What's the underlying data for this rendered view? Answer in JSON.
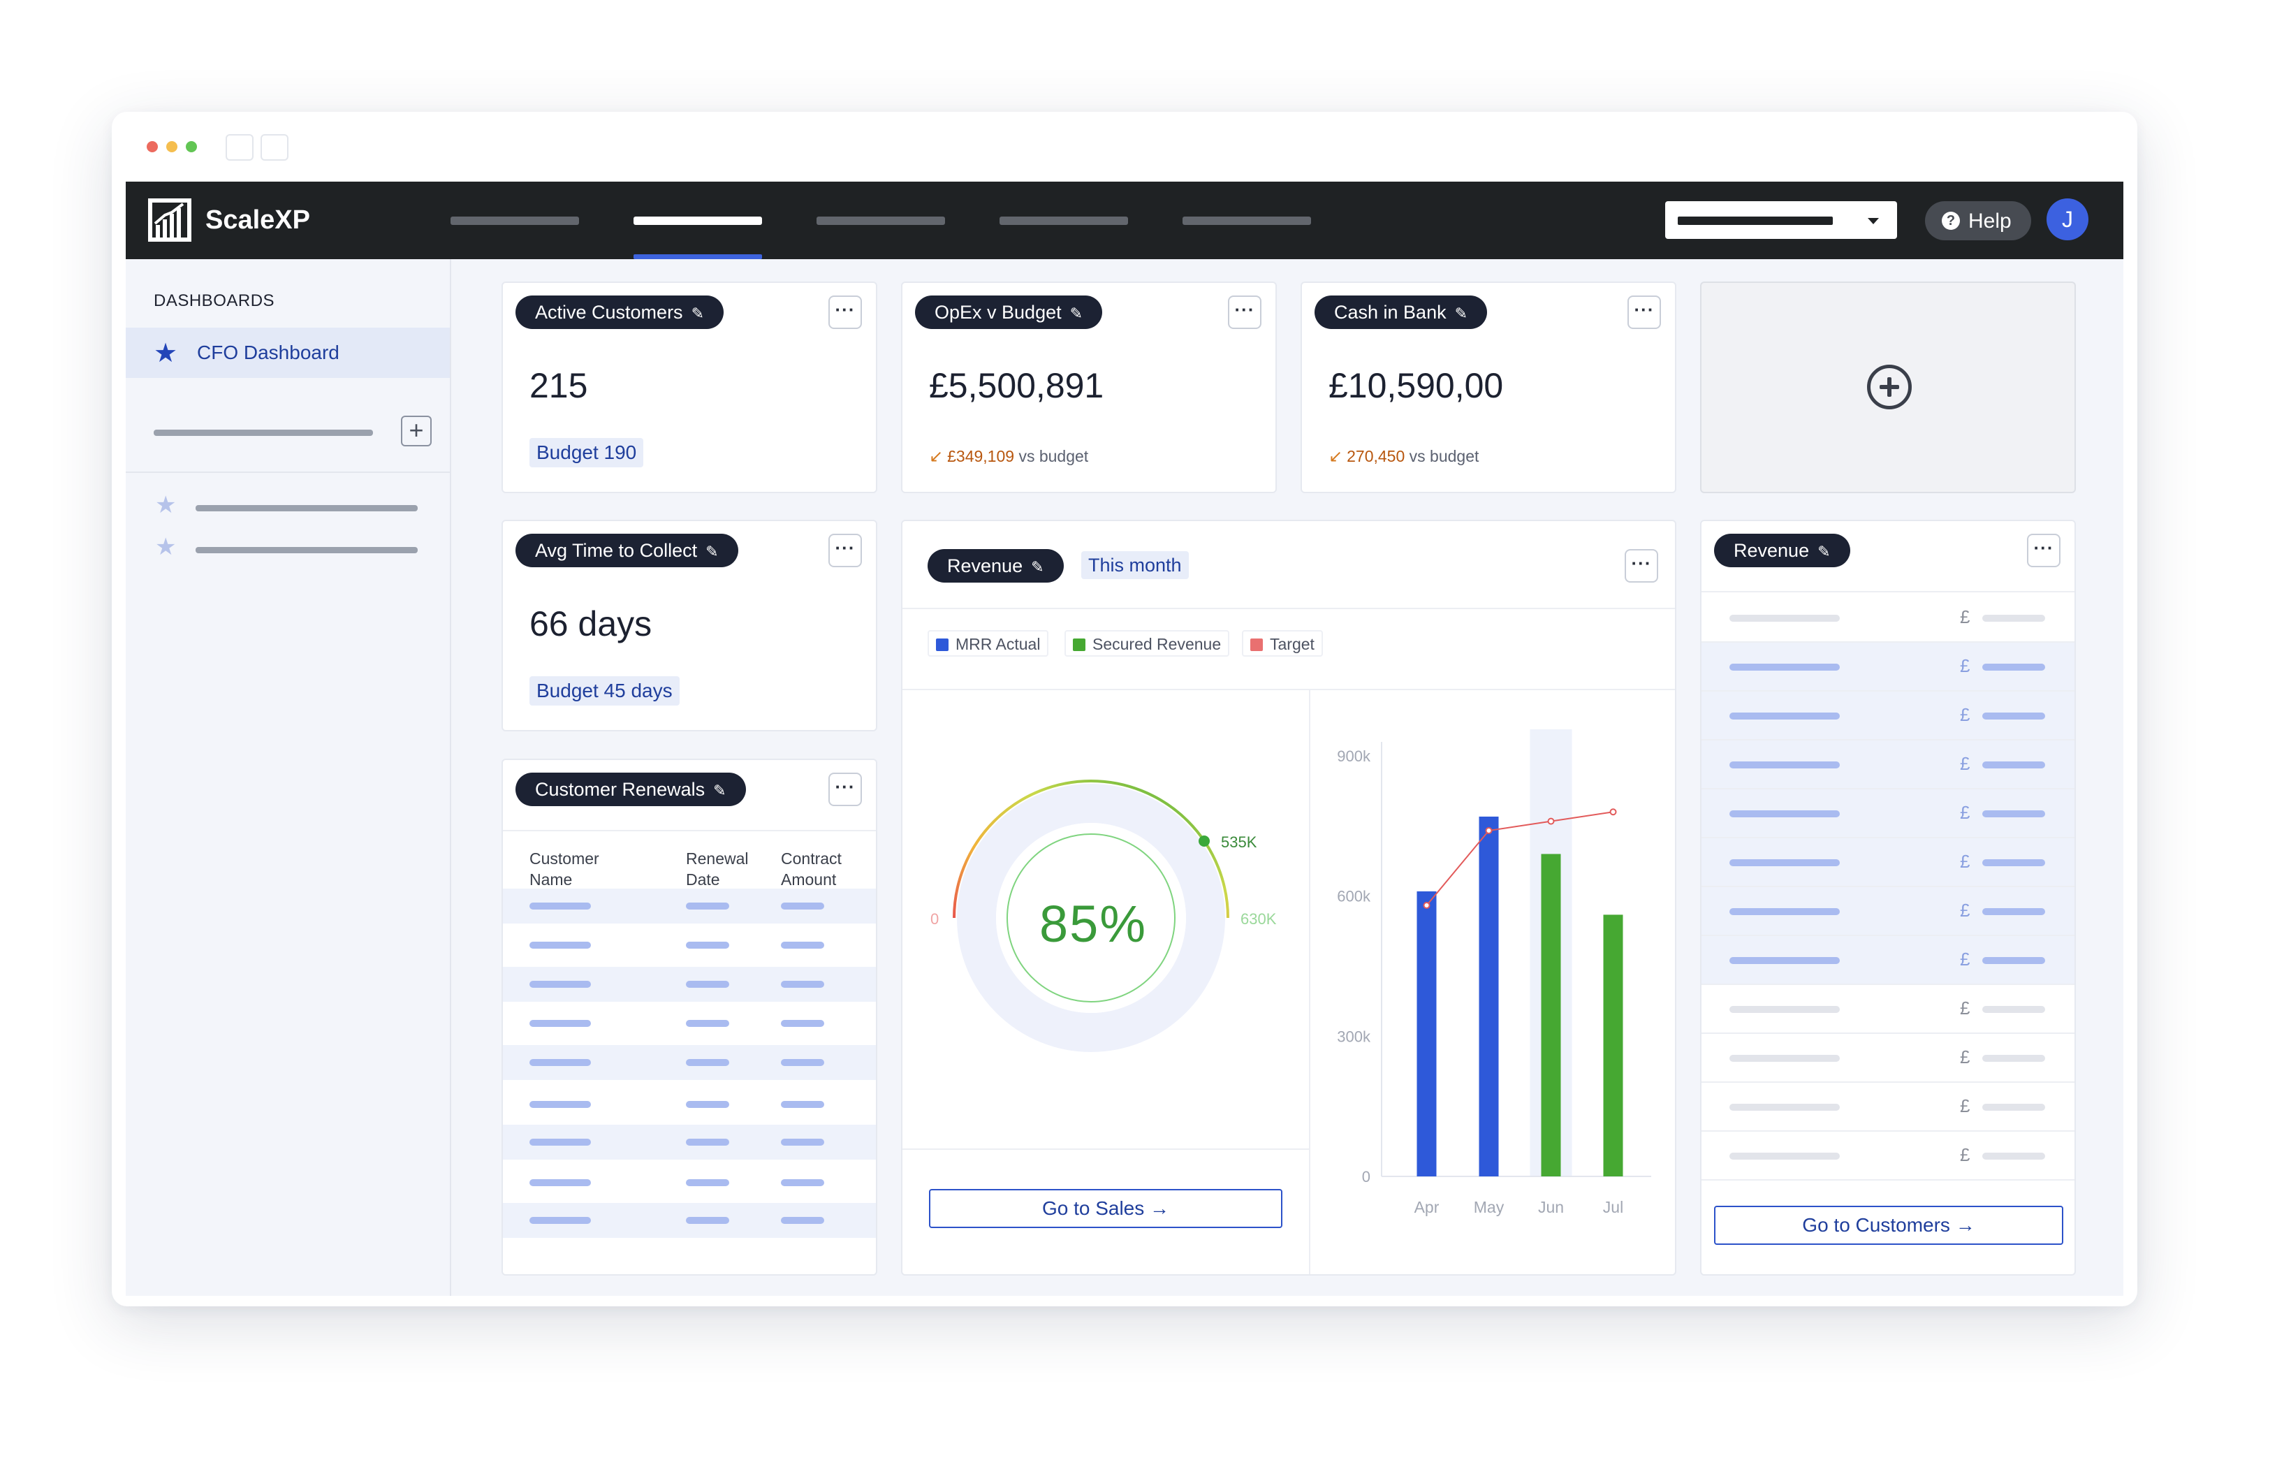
{
  "window": {
    "dot_colors": [
      "#ec6a5e",
      "#f5be4f",
      "#62c554"
    ]
  },
  "app": {
    "brand": "ScaleXP",
    "help_label": "Help",
    "help_icon": "question-circle-icon",
    "avatar_initial": "J",
    "accent": "#2c52c9"
  },
  "sidebar": {
    "section_title": "DASHBOARDS",
    "active_item": "CFO Dashboard",
    "active_icon": "star-icon"
  },
  "cards": {
    "active_customers": {
      "title": "Active Customers",
      "value": "215",
      "budget": "Budget 190"
    },
    "opex": {
      "title": "OpEx v Budget",
      "value": "£5,500,891",
      "delta": "£349,109",
      "delta_suffix": "vs budget"
    },
    "cash": {
      "title": "Cash in Bank",
      "value": "£10,590,00",
      "delta": "270,450",
      "delta_suffix": "vs budget"
    },
    "avg_collect": {
      "title": "Avg Time to Collect",
      "value": "66 days",
      "budget": "Budget 45 days"
    },
    "renewals": {
      "title": "Customer Renewals",
      "columns": [
        [
          "Customer",
          "Name"
        ],
        [
          "Renewal",
          "Date"
        ],
        [
          "Contract",
          "Amount"
        ]
      ]
    },
    "revenue": {
      "title": "Revenue",
      "period": "This month",
      "legend": [
        "MRR Actual",
        "Secured Revenue",
        "Target"
      ],
      "gauge": {
        "percent": "85%",
        "zero": "0",
        "marker": "535K",
        "target": "630K"
      },
      "button": "Go to Sales →"
    },
    "revenue_list": {
      "title": "Revenue",
      "currency_symbol": "£",
      "button": "Go to Customers →"
    }
  },
  "chart_data": {
    "type": "bar",
    "categories": [
      "Apr",
      "May",
      "Jun",
      "Jul"
    ],
    "y_ticks": [
      "900k",
      "600k",
      "300k",
      "0"
    ],
    "ylim": [
      0,
      900000
    ],
    "series": [
      {
        "name": "MRR Actual",
        "values": [
          610000,
          770000,
          null,
          null
        ],
        "color": "#2e59d9"
      },
      {
        "name": "Secured Revenue",
        "values": [
          null,
          null,
          690000,
          560000
        ],
        "color": "#46a832"
      },
      {
        "name": "Target",
        "values": [
          580000,
          740000,
          760000,
          780000
        ],
        "color": "#e25a5a"
      }
    ]
  }
}
